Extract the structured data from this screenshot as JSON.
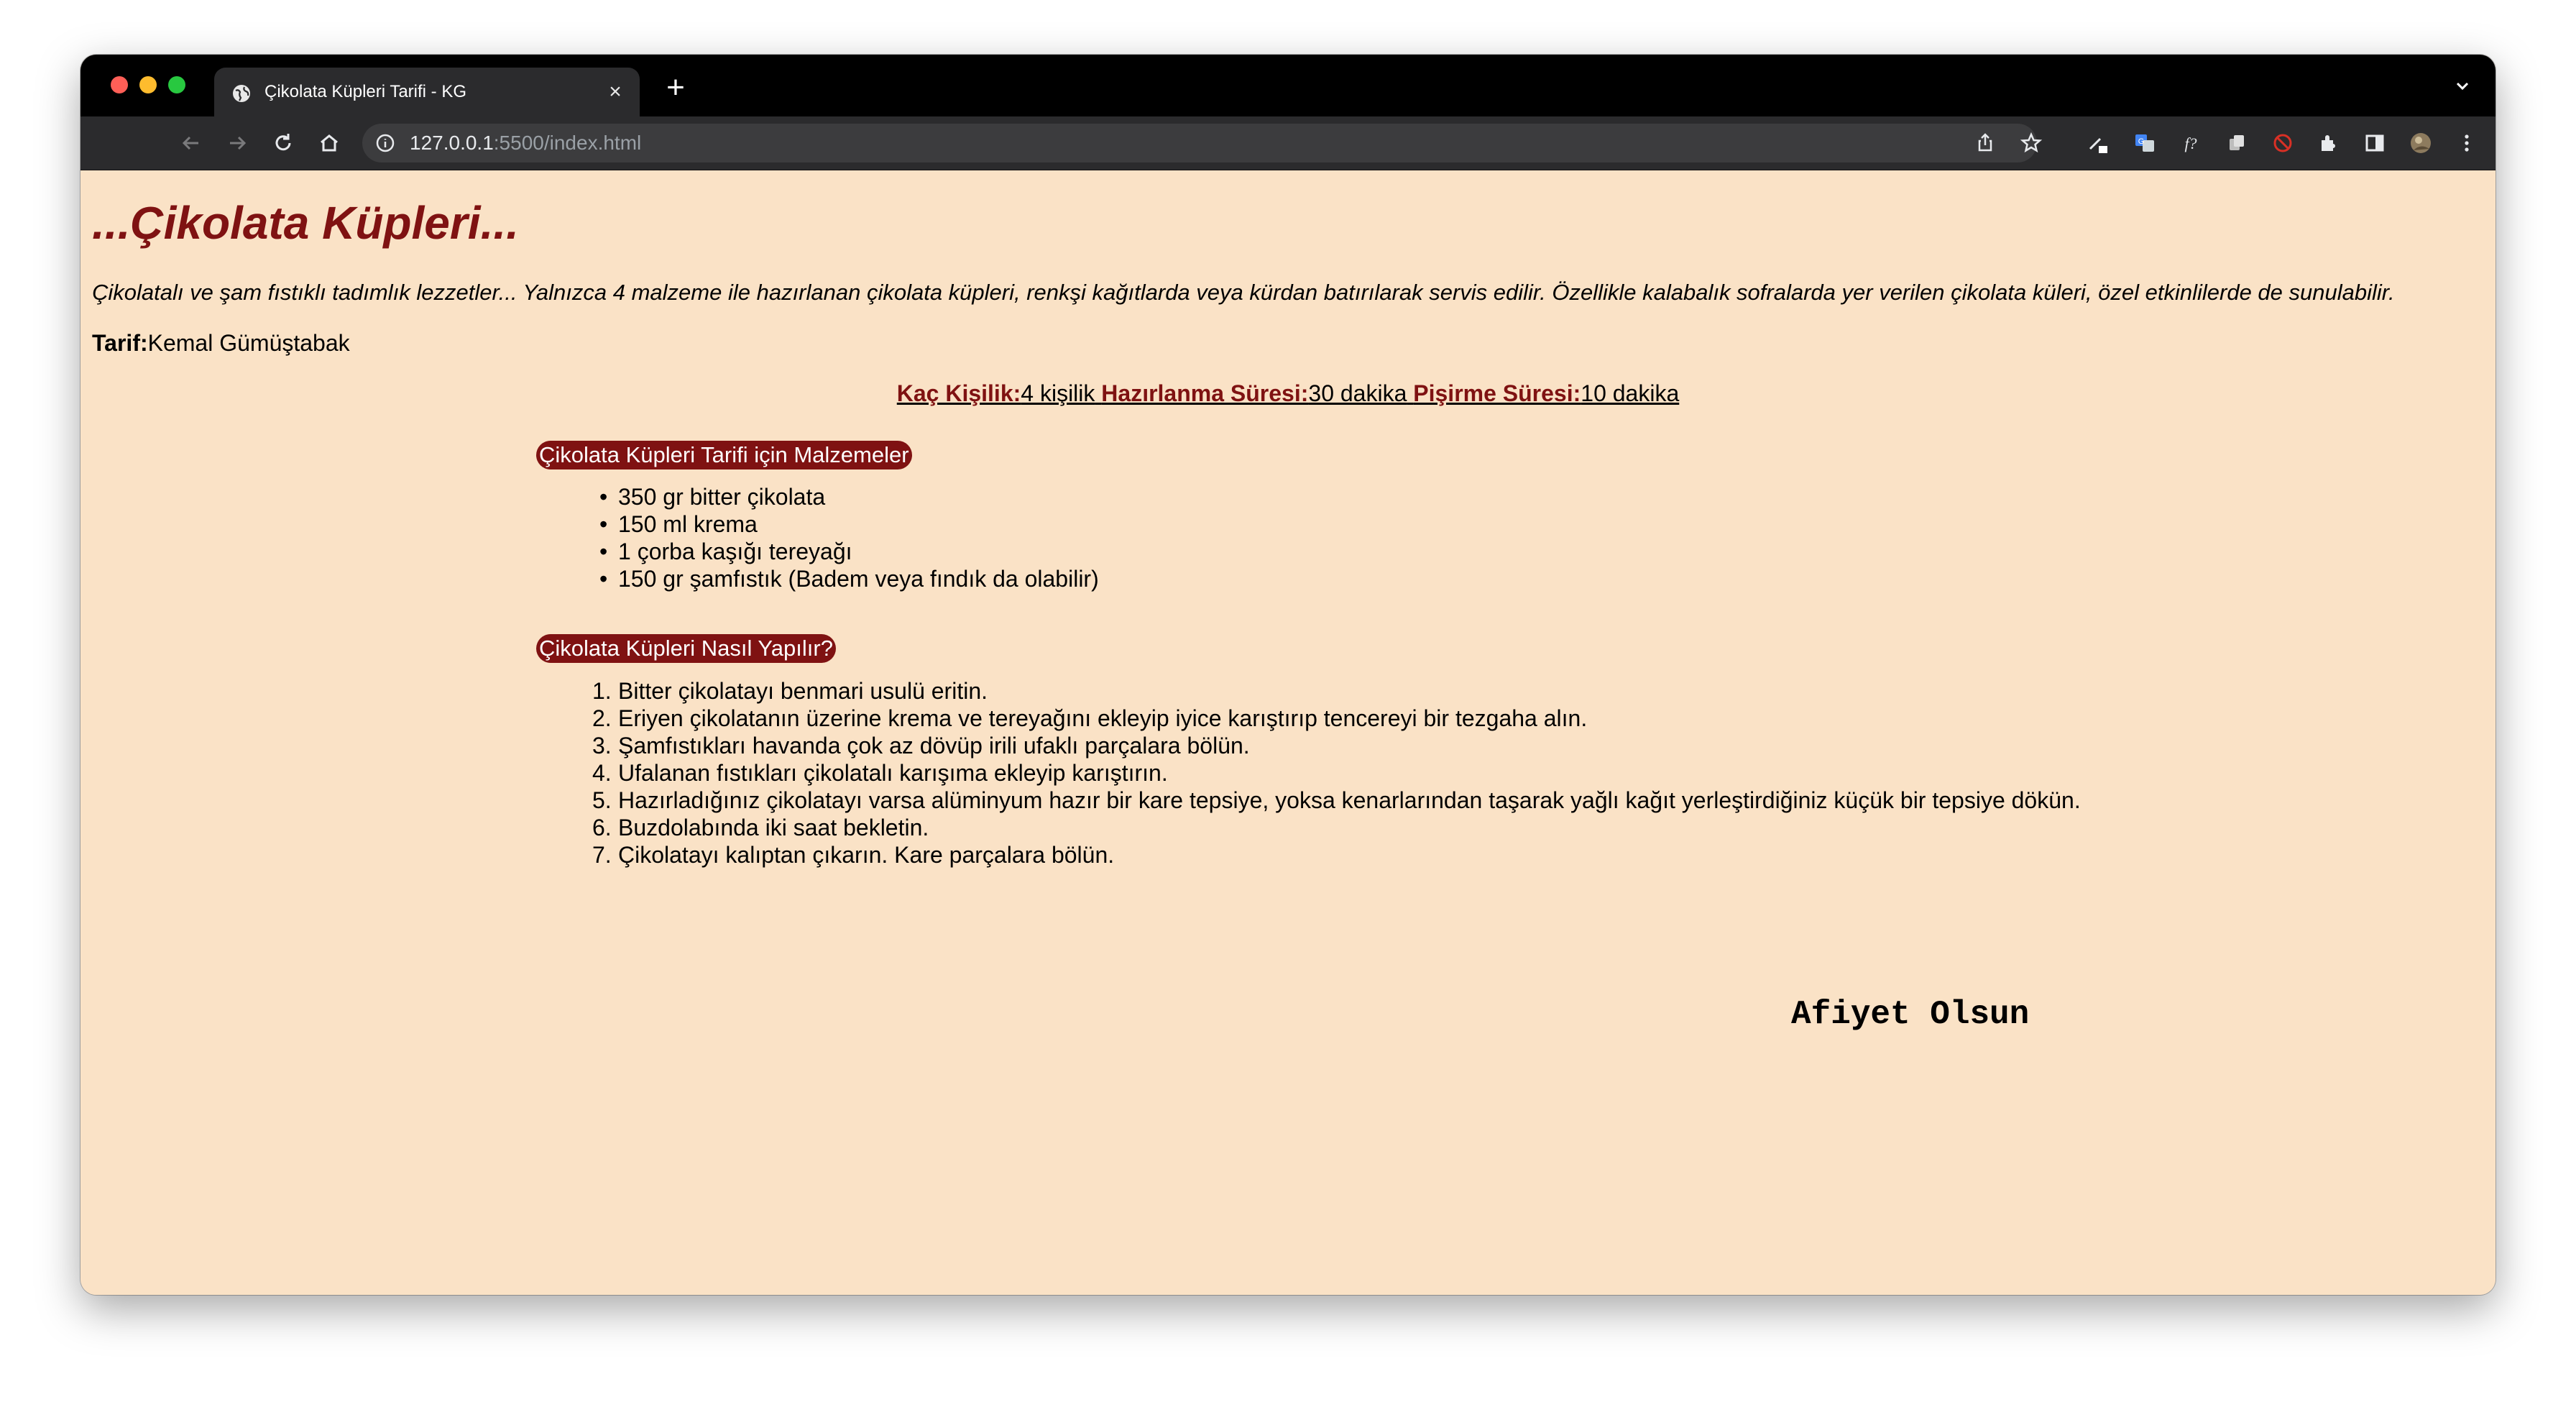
{
  "browser": {
    "tab": {
      "title": "Çikolata Küpleri Tarifi - KG"
    },
    "omnibox": {
      "host": "127.0.0.1",
      "path": ":5500/index.html"
    }
  },
  "page": {
    "title": "...Çikolata Küpleri...",
    "intro": "Çikolatalı ve şam fıstıklı tadımlık lezzetler... Yalnızca 4 malzeme ile hazırlanan çikolata küpleri, renkşi kağıtlarda veya kürdan batırılarak servis edilir. Özellikle kalabalık sofralarda yer verilen çikolata küleri, özel etkinlilerde de sunulabilir.",
    "author_label": "Tarif:",
    "author_name": "Kemal Gümüştabak",
    "meta": {
      "servings_label": "Kaç Kişilik:",
      "servings_value": "4 kişilik",
      "prep_label": "Hazırlanma Süresi:",
      "prep_value": "30 dakika",
      "cook_label": "Pişirme Süresi:",
      "cook_value": "10 dakika"
    },
    "ingredients_heading": "Çikolata Küpleri Tarifi için Malzemeler",
    "ingredients": [
      "350 gr bitter çikolata",
      "150 ml krema",
      "1 çorba kaşığı tereyağı",
      "150 gr şamfıstık (Badem veya fındık da olabilir)"
    ],
    "steps_heading": "Çikolata Küpleri Nasıl Yapılır?",
    "steps": [
      {
        "n": "1.",
        "text": "Bitter çikolatayı benmari usulü eritin."
      },
      {
        "n": "2.",
        "text": "Eriyen çikolatanın üzerine krema ve tereyağını ekleyip iyice karıştırıp tencereyi bir tezgaha alın."
      },
      {
        "n": "3.",
        "text": "Şamfıstıkları havanda çok az dövüp irili ufaklı parçalara bölün."
      },
      {
        "n": "4.",
        "text": "Ufalanan fıstıkları çikolatalı karışıma ekleyip karıştırın."
      },
      {
        "n": "5.",
        "text": "Hazırladığınız çikolatayı varsa alüminyum hazır bir kare tepsiye, yoksa kenarlarından taşarak yağlı kağıt yerleştirdiğiniz küçük bir tepsiye dökün."
      },
      {
        "n": "6.",
        "text": "Buzdolabında iki saat bekletin."
      },
      {
        "n": "7.",
        "text": "Çikolatayı kalıptan çıkarın. Kare parçalara bölün."
      }
    ],
    "signoff": "Afiyet Olsun"
  },
  "colors": {
    "accent": "#7f1212",
    "page_bg": "#fae2c6"
  }
}
